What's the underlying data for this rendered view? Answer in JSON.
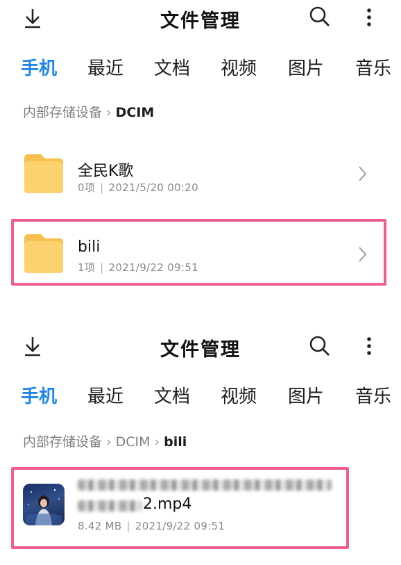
{
  "panels": [
    {
      "title": "文件管理",
      "tabs": [
        "手机",
        "最近",
        "文档",
        "视频",
        "图片",
        "音乐"
      ],
      "active_tab": "手机",
      "breadcrumb": [
        "内部存储设备",
        "DCIM"
      ],
      "items": [
        {
          "name": "全民K歌",
          "meta_count": "0项",
          "meta_date": "2021/5/20 00:20",
          "type": "folder"
        },
        {
          "name": "bili",
          "meta_count": "1项",
          "meta_date": "2021/9/22 09:51",
          "type": "folder",
          "highlighted": true
        }
      ]
    },
    {
      "title": "文件管理",
      "tabs": [
        "手机",
        "最近",
        "文档",
        "视频",
        "图片",
        "音乐"
      ],
      "active_tab": "手机",
      "breadcrumb": [
        "内部存储设备",
        "DCIM",
        "bili"
      ],
      "items": [
        {
          "name_visible": "2.mp4",
          "meta_size": "8.42 MB",
          "meta_date": "2021/9/22 09:51",
          "type": "video",
          "highlighted": true
        }
      ]
    }
  ],
  "colors": {
    "accent": "#1e86e6",
    "highlight": "#f05e8e",
    "folder": "#fcd26e"
  },
  "icons": [
    "download-icon",
    "search-icon",
    "more-vertical-icon",
    "folder-icon",
    "chevron-right-icon",
    "video-thumbnail"
  ]
}
